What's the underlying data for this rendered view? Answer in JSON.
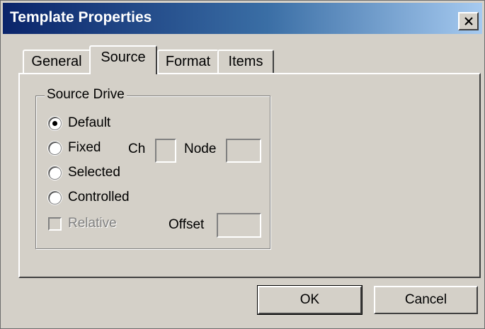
{
  "window": {
    "title": "Template Properties",
    "close_glyph": "✕"
  },
  "tabs": [
    {
      "label": "General",
      "active": false
    },
    {
      "label": "Source",
      "active": true
    },
    {
      "label": "Format",
      "active": false
    },
    {
      "label": "Items",
      "active": false
    }
  ],
  "source_drive": {
    "group_label": "Source Drive",
    "options": [
      {
        "label": "Default",
        "selected": true
      },
      {
        "label": "Fixed",
        "selected": false
      },
      {
        "label": "Selected",
        "selected": false
      },
      {
        "label": "Controlled",
        "selected": false
      }
    ],
    "ch_label": "Ch",
    "ch_value": "",
    "node_label": "Node",
    "node_value": "",
    "relative_label": "Relative",
    "relative_checked": false,
    "relative_enabled": false,
    "offset_label": "Offset",
    "offset_value": ""
  },
  "buttons": {
    "ok": "OK",
    "cancel": "Cancel"
  }
}
